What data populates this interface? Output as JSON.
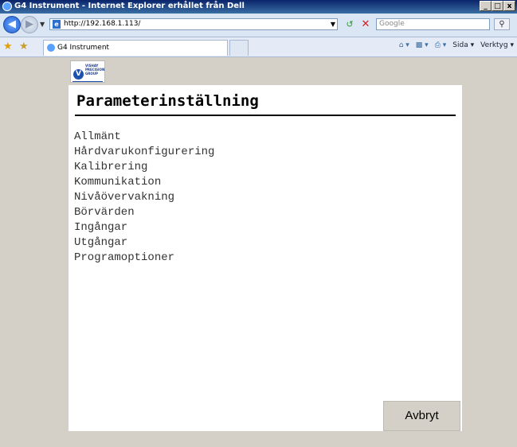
{
  "window": {
    "title": "G4 Instrument - Internet Explorer erhållet från Dell",
    "buttons": {
      "minimize": "_",
      "maximize": "□",
      "close": "x"
    }
  },
  "addressbar": {
    "url": "http://192.168.1.113/",
    "search_placeholder": "Google"
  },
  "tabbar": {
    "tab_title": "G4 Instrument",
    "commands": {
      "page": "Sida",
      "tools": "Verktyg"
    }
  },
  "logo": {
    "text": "VISHAY PRECISION GROUP",
    "letter": "V"
  },
  "page": {
    "heading": "Parameterinställning",
    "menu_items": [
      "Allmänt",
      "Hårdvarukonfigurering",
      "Kalibrering",
      "Kommunikation",
      "Nivåövervakning",
      "Börvärden",
      "Ingångar",
      "Utgångar",
      "Programoptioner"
    ],
    "cancel_label": "Avbryt"
  }
}
